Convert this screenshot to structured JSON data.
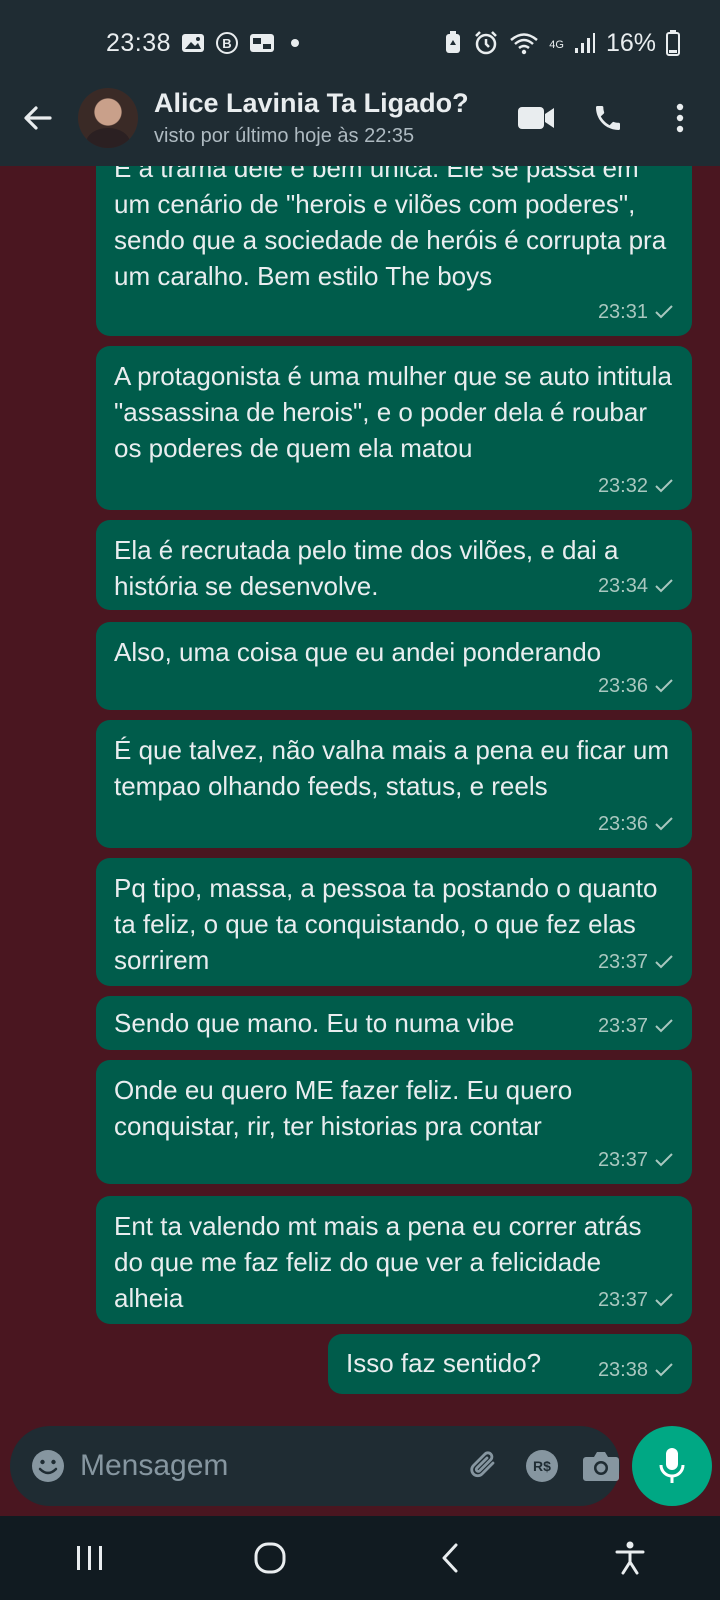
{
  "status_bar": {
    "time": "23:38",
    "battery": "16%",
    "network": "4G"
  },
  "header": {
    "name": "Alice Lavinia Ta Ligado?",
    "last_seen": "visto por último hoje às 22:35"
  },
  "messages": [
    {
      "text": "E a trama dele é bem única. Ele se passa em um cenário de \"herois e vilões com poderes\", sendo que a sociedade de heróis é corrupta pra um caralho. Bem estilo The boys",
      "time": "23:31"
    },
    {
      "text": "A protagonista é uma mulher que se auto intitula \"assassina de herois\", e o poder dela é roubar os poderes de quem ela matou",
      "time": "23:32"
    },
    {
      "text": "Ela é recrutada pelo time dos vilões, e dai a história se desenvolve.",
      "time": "23:34"
    },
    {
      "text": "Also, uma coisa que eu andei ponderando",
      "time": "23:36"
    },
    {
      "text": "É que talvez, não valha mais a pena eu ficar um tempao olhando feeds, status, e reels",
      "time": "23:36"
    },
    {
      "text": "Pq tipo, massa, a pessoa ta postando o quanto ta feliz, o que ta conquistando, o que fez elas sorrirem",
      "time": "23:37"
    },
    {
      "text": "Sendo que mano. Eu to numa vibe",
      "time": "23:37"
    },
    {
      "text": "Onde eu quero ME fazer feliz. Eu quero conquistar, rir, ter historias pra contar",
      "time": "23:37"
    },
    {
      "text": "Ent ta valendo mt mais a pena eu correr atrás do que me faz feliz do que ver a felicidade alheia",
      "time": "23:37"
    },
    {
      "text": "Isso faz sentido?",
      "time": "23:38"
    }
  ],
  "composer": {
    "placeholder": "Mensagem",
    "currency_label": "R$"
  },
  "colors": {
    "outgoing_bubble": "#005c4b",
    "header_bg": "#1f2c33",
    "wallpaper": "#4a1620",
    "accent": "#00a884"
  }
}
